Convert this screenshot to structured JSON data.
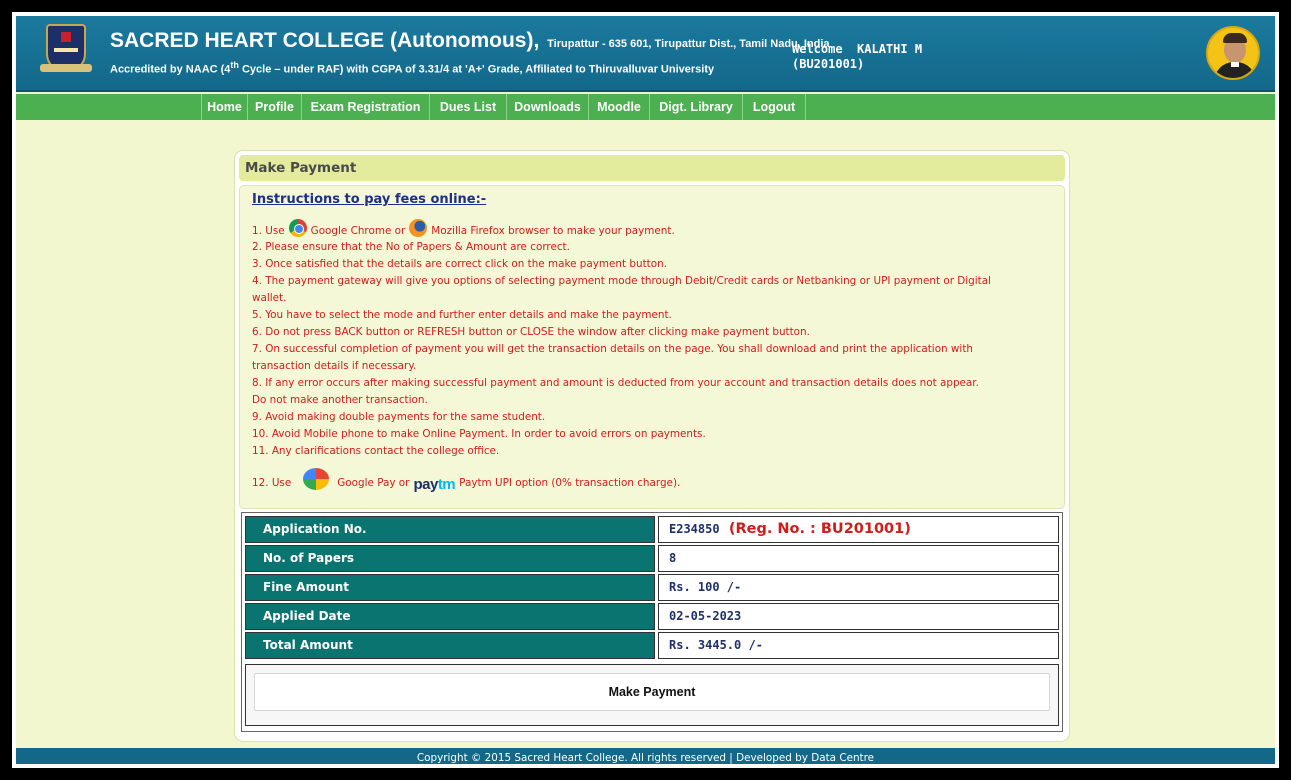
{
  "header": {
    "college_name": "SACRED HEART COLLEGE (Autonomous),",
    "address": "Tirupattur - 635 601, Tirupattur Dist., Tamil Nadu, India",
    "accreditation_pre": "Accredited by NAAC (4",
    "accreditation_sup": "th",
    "accreditation_post": " Cycle – under RAF) with CGPA of 3.31/4 at 'A+' Grade, Affiliated to Thiruvalluvar University",
    "welcome": "Welcome  KALATHI M",
    "reg_no": "(BU201001)"
  },
  "nav": [
    "Home",
    "Profile",
    "Exam Registration",
    "Dues List",
    "Downloads",
    "Moodle",
    "Digt. Library",
    "Logout"
  ],
  "panel": {
    "title": "Make Payment",
    "instructions_title": "Instructions to pay fees online:-",
    "line1_a": "1. Use",
    "line1_b": "Google Chrome or",
    "line1_c": "Mozilla Firefox browser to make your payment.",
    "lines": [
      "2. Please ensure that the No of Papers & Amount are correct.",
      "3. Once satisfied that the details are correct click on the make payment button.",
      "4. The payment gateway will give you options of selecting payment mode through Debit/Credit cards or Netbanking or UPI payment or Digital",
      "wallet.",
      "5. You have to select the mode and further enter details and make the payment.",
      "6. Do not press BACK button or REFRESH button or CLOSE the window after clicking make payment button.",
      "7. On successful completion of payment you will get the transaction details on the page. You shall download and print the application with",
      "transaction details if necessary.",
      "8. If any error occurs after making successful payment and amount is deducted from your account and transaction details does not appear.",
      "Do not make another transaction.",
      "9. Avoid making double payments for the same student.",
      "10. Avoid Mobile phone to make Online Payment. In order to avoid errors on payments.",
      "11. Any clarifications contact the college office."
    ],
    "line12_a": "12. Use",
    "line12_b": "Google Pay or",
    "paytm_logo_a": "pay",
    "paytm_logo_b": "tm",
    "line12_c": "Paytm UPI option (0% transaction charge)."
  },
  "details": [
    {
      "label": "Application No.",
      "value": "E234850",
      "extra": "(Reg. No. : BU201001)"
    },
    {
      "label": "No. of Papers",
      "value": "8"
    },
    {
      "label": "Fine Amount",
      "value": "Rs. 100 /-"
    },
    {
      "label": "Applied Date",
      "value": "02-05-2023"
    },
    {
      "label": "Total Amount",
      "value": "Rs. 3445.0 /-"
    }
  ],
  "pay_button": "Make Payment",
  "footer": "Copyright © 2015 Sacred Heart College. All rights reserved | Developed by Data Centre",
  "colors": {
    "header": "#13688a",
    "nav": "#4caf50",
    "label_cell": "#0a7471",
    "instruction_text": "#d21c1c",
    "page_bg": "#f2f7d0"
  }
}
